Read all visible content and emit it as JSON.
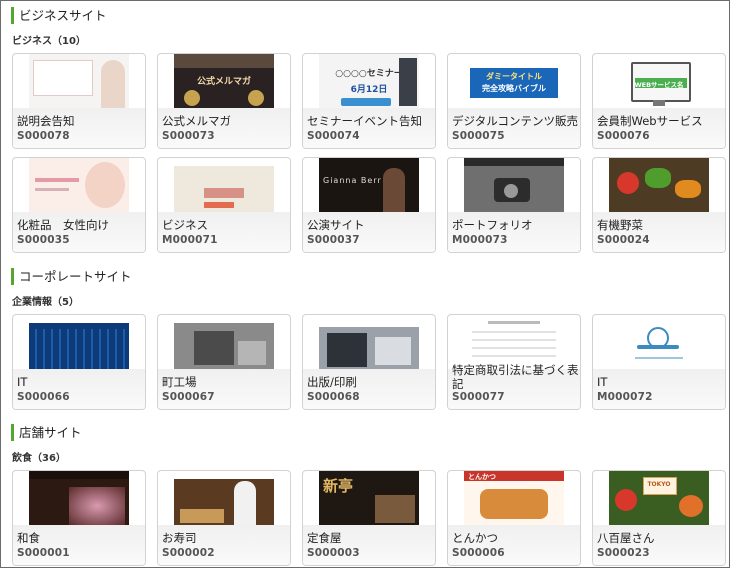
{
  "sections": {
    "business_site": {
      "title": "ビジネスサイト",
      "subcategory": "ビジネス（10）",
      "cards": [
        {
          "name": "説明会告知",
          "code": "S000078"
        },
        {
          "name": "公式メルマガ",
          "code": "S000073"
        },
        {
          "name": "セミナーイベント告知",
          "code": "S000074"
        },
        {
          "name": "デジタルコンテンツ販売",
          "code": "S000075"
        },
        {
          "name": "会員制Webサービス",
          "code": "S000076"
        },
        {
          "name": "化粧品　女性向け",
          "code": "S000035"
        },
        {
          "name": "ビジネス",
          "code": "M000071"
        },
        {
          "name": "公演サイト",
          "code": "S000037"
        },
        {
          "name": "ポートフォリオ",
          "code": "M000073"
        },
        {
          "name": "有機野菜",
          "code": "S000024"
        }
      ]
    },
    "corporate_site": {
      "title": "コーポレートサイト",
      "subcategory": "企業情報（5）",
      "cards": [
        {
          "name": "IT",
          "code": "S000066"
        },
        {
          "name": "町工場",
          "code": "S000067"
        },
        {
          "name": "出版/印刷",
          "code": "S000068"
        },
        {
          "name": "特定商取引法に基づく表記",
          "code": "S000077"
        },
        {
          "name": "IT",
          "code": "M000072"
        }
      ]
    },
    "shop_site": {
      "title": "店舗サイト",
      "subcategory": "飲食（36）",
      "cards": [
        {
          "name": "和食",
          "code": "S000001"
        },
        {
          "name": "お寿司",
          "code": "S000002"
        },
        {
          "name": "定食屋",
          "code": "S000003"
        },
        {
          "name": "とんかつ",
          "code": "S000006"
        },
        {
          "name": "八百屋さん",
          "code": "S000023"
        }
      ]
    }
  },
  "thumb_text": {
    "mailmag": "公式メルマガ",
    "seminar": "○○○○セミナー",
    "seminar_date": "6月12日",
    "digital_1": "ダミータイトル",
    "digital_2": "完全攻略バイブル",
    "member": "WEBサービス名",
    "gianna": "Gianna Berr",
    "shinjuku": "新亭",
    "tonkatsu": "とんかつ",
    "tokyo": "TOKYO"
  },
  "colors": {
    "accent_bar": "#55a531",
    "card_border": "#d2d2d2",
    "frame_border": "#6b6b6b"
  }
}
